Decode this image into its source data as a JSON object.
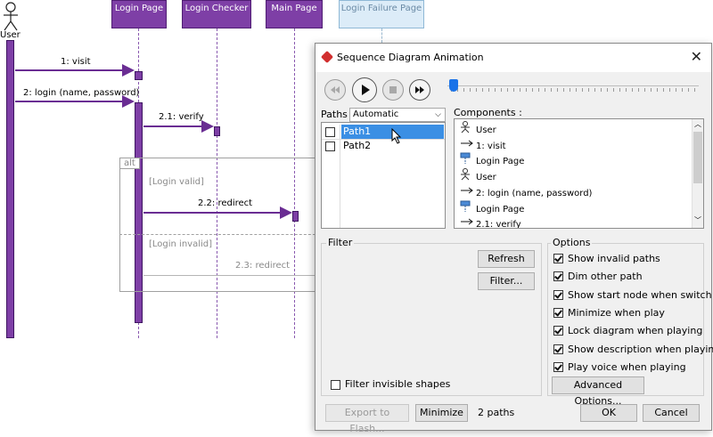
{
  "diagram": {
    "actor": "User",
    "lifelines": [
      "Login Page",
      "Login Checker",
      "Main Page",
      "Login Failure Page"
    ],
    "messages": [
      "1: visit",
      "2: login (name, password)",
      "2.1: verify",
      "2.2: redirect",
      "2.3: redirect"
    ],
    "fragment": {
      "tag": "alt",
      "guards": [
        "[Login valid]",
        "[Login invalid]"
      ]
    }
  },
  "dialog": {
    "title": "Sequence Diagram Animation",
    "player_icons": [
      "rewind-icon",
      "play-icon",
      "stop-icon",
      "fast-forward-icon"
    ],
    "progress": 0.0,
    "paths_label": "Paths :",
    "paths_mode": "Automatic",
    "paths": [
      {
        "label": "Path1",
        "checked": false,
        "selected": true
      },
      {
        "label": "Path2",
        "checked": false,
        "selected": false
      }
    ],
    "components_label": "Components :",
    "components": [
      {
        "icon": "actor-icon",
        "label": "User"
      },
      {
        "icon": "message-arrow-icon",
        "label": "1: visit"
      },
      {
        "icon": "lifeline-icon",
        "label": "Login Page"
      },
      {
        "icon": "actor-icon",
        "label": "User"
      },
      {
        "icon": "message-arrow-icon",
        "label": "2: login (name, password)"
      },
      {
        "icon": "lifeline-icon",
        "label": "Login Page"
      },
      {
        "icon": "message-arrow-icon",
        "label": "2.1: verify"
      }
    ],
    "filter": {
      "title": "Filter",
      "refresh": "Refresh",
      "filter_button": "Filter...",
      "invisible_label": "Filter invisible shapes",
      "invisible_checked": false
    },
    "options": {
      "title": "Options",
      "items": [
        {
          "label": "Show invalid paths",
          "checked": true
        },
        {
          "label": "Dim other path",
          "checked": true
        },
        {
          "label": "Show start node when switch path",
          "checked": true
        },
        {
          "label": "Minimize when play",
          "checked": true
        },
        {
          "label": "Lock diagram when playing",
          "checked": true
        },
        {
          "label": "Show description when playing",
          "checked": true
        },
        {
          "label": "Play voice when playing",
          "checked": true
        }
      ],
      "advanced": "Advanced Options..."
    },
    "footer": {
      "export": "Export to Flash...",
      "minimize": "Minimize",
      "count": "2 paths",
      "ok": "OK",
      "cancel": "Cancel"
    }
  }
}
